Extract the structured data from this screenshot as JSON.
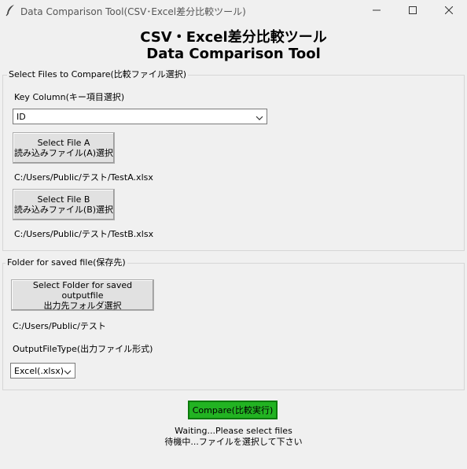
{
  "window": {
    "title": "Data Comparison Tool(CSV･Excel差分比較ツール)"
  },
  "header": {
    "title_line1": "CSV・Excel差分比較ツール",
    "title_line2": "Data Comparison Tool"
  },
  "select_files": {
    "group_label": "Select Files to Compare(比較ファイル選択)",
    "key_column_label": "Key Column(キー項目選択)",
    "key_column_value": "ID",
    "file_a_button_line1": "Select File A",
    "file_a_button_line2": "読み込みファイル(A)選択",
    "file_a_path": "C:/Users/Public/テスト/TestA.xlsx",
    "file_b_button_line1": "Select File B",
    "file_b_button_line2": "読み込みファイル(B)選択",
    "file_b_path": "C:/Users/Public/テスト/TestB.xlsx"
  },
  "save_folder": {
    "group_label": "Folder for saved file(保存先)",
    "folder_button_line1": "Select Folder for saved outputfile",
    "folder_button_line2": "出力先フォルダ選択",
    "folder_path": "C:/Users/Public/テスト",
    "output_type_label": "OutputFileType(出力ファイル形式)",
    "output_type_value": "Excel(.xlsx)"
  },
  "compare_button_label": "Compare(比較実行)",
  "status": {
    "line1": "Waiting...Please select files",
    "line2": "待機中...ファイルを選択して下さい"
  },
  "icons": {
    "app": "feather-icon",
    "minimize": "minimize-icon",
    "maximize": "maximize-icon",
    "close": "close-icon",
    "dropdown": "chevron-down-icon"
  },
  "colors": {
    "compare_button": "#22b322",
    "window_bg": "#f0f0f0"
  }
}
